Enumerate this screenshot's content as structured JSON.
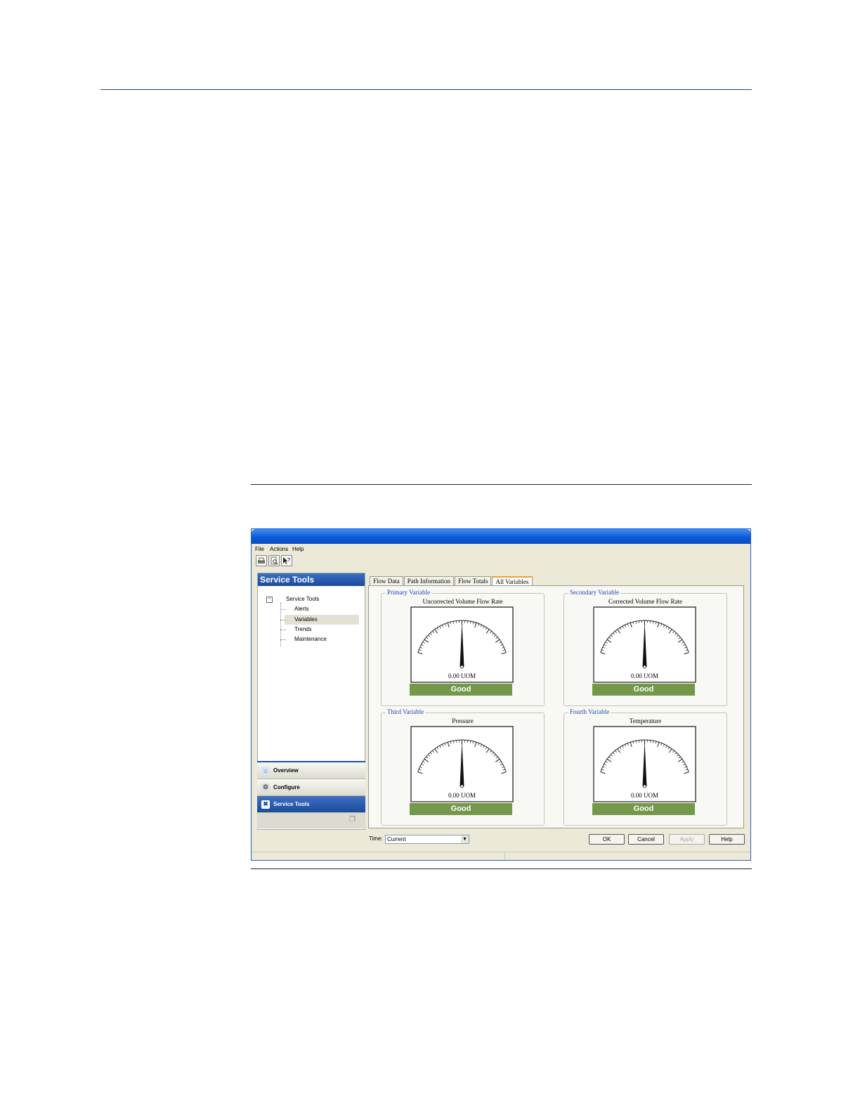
{
  "window": {
    "menu": [
      "File",
      "Actions",
      "Help"
    ],
    "toolbar_icons": [
      "print-icon",
      "print-preview-icon",
      "help-pointer-icon"
    ]
  },
  "left_pane": {
    "header": "Service Tools",
    "tree": {
      "root": "Service Tools",
      "children": [
        "Alerts",
        "Variables",
        "Trends",
        "Maintenance"
      ],
      "selected": "Variables"
    },
    "nav": [
      {
        "label": "Overview",
        "icon": "home-icon"
      },
      {
        "label": "Configure",
        "icon": "configure-icon"
      },
      {
        "label": "Service Tools",
        "icon": "service-tools-icon"
      }
    ]
  },
  "tabs": [
    "Flow Data",
    "Path Information",
    "Flow Totals",
    "All Variables"
  ],
  "active_tab": "All Variables",
  "gauges": [
    {
      "group": "Primary Variable",
      "name": "Uncorrected Volume Flow Rate",
      "reading": "0.00 UOM",
      "status": "Good"
    },
    {
      "group": "Secondary Variable",
      "name": "Corrected Volume Flow Rate",
      "reading": "0.00 UOM",
      "status": "Good"
    },
    {
      "group": "Third Variable",
      "name": "Pressure",
      "reading": "0.00 UOM",
      "status": "Good"
    },
    {
      "group": "Fourth Variable",
      "name": "Temperature",
      "reading": "0.00 UOM",
      "status": "Good"
    }
  ],
  "colors": {
    "status_good": "#74984a",
    "group_title": "#1f47b0",
    "header_blue": "#1b4a9c"
  },
  "footer": {
    "time_label": "Time:",
    "time_value": "Current",
    "buttons": {
      "ok": "OK",
      "cancel": "Cancel",
      "apply": "Apply",
      "help": "Help"
    }
  }
}
